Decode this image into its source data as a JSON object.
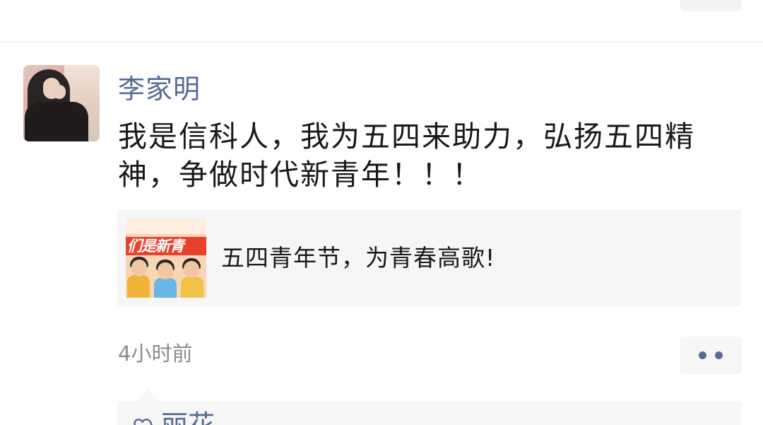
{
  "post": {
    "author": "李家明",
    "text": "我是信科人，我为五四来助力，弘扬五四精神，争做时代新青年！！！",
    "time": "4小时前"
  },
  "link_card": {
    "title": "五四青年节，为青春高歌!",
    "thumbnail_banner": "们是新青"
  },
  "likes": {
    "first_liker": "丽花"
  },
  "colors": {
    "name_blue": "#576b95",
    "text": "#191919",
    "muted": "#8c8c8c",
    "card_bg": "#f6f6f7",
    "thumb_red": "#e8412e"
  },
  "icons": {
    "more": "two-dot-icon",
    "likes": "heart-icon"
  }
}
